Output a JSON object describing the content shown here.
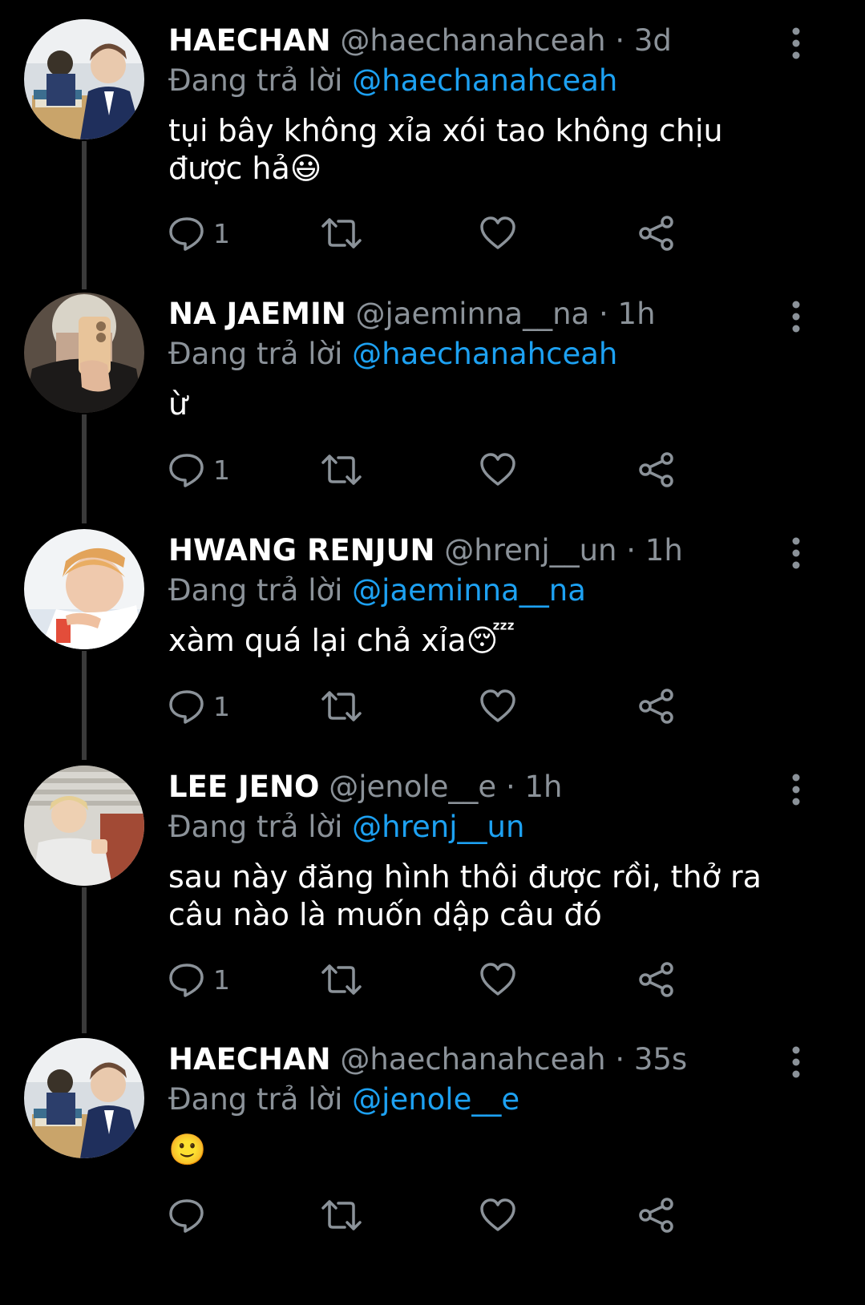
{
  "colors": {
    "background": "#000000",
    "name": "#ffffff",
    "muted": "#8b9299",
    "mention": "#1da1f2",
    "thread_line": "#3a3a3a"
  },
  "icons": {
    "reply": "speech-bubble-icon",
    "retweet": "retweet-icon",
    "like": "heart-icon",
    "share": "share-icon",
    "more": "vertical-dots-icon"
  },
  "tweets": [
    {
      "name": "HAECHAN",
      "handle": "@haechanahceah",
      "separator": "·",
      "time": "3d",
      "replying_label": "Đang trả lời",
      "replying_to": "@haechanahceah",
      "text": "tụi bây không xỉa xói tao không chịu được hả😃",
      "reply_count": "1"
    },
    {
      "name": "NA JAEMIN",
      "handle": "@jaeminna__na",
      "separator": "·",
      "time": "1h",
      "replying_label": "Đang trả lời",
      "replying_to": "@haechanahceah",
      "text": "ừ",
      "reply_count": "1"
    },
    {
      "name": "HWANG RENJUN",
      "handle": "@hrenj__un",
      "separator": "·",
      "time": "1h",
      "replying_label": "Đang trả lời",
      "replying_to": "@jaeminna__na",
      "text": "xàm quá lại chả xỉa😴",
      "reply_count": "1"
    },
    {
      "name": "LEE JENO",
      "handle": "@jenole__e",
      "separator": "·",
      "time": "1h",
      "replying_label": "Đang trả lời",
      "replying_to": "@hrenj__un",
      "text": "sau này đăng hình thôi được rồi, thở ra câu nào là muốn dập câu đó",
      "reply_count": "1"
    },
    {
      "name": "HAECHAN",
      "handle": "@haechanahceah",
      "separator": "·",
      "time": "35s",
      "replying_label": "Đang trả lời",
      "replying_to": "@jenole__e",
      "text": "🙂",
      "reply_count": ""
    }
  ]
}
